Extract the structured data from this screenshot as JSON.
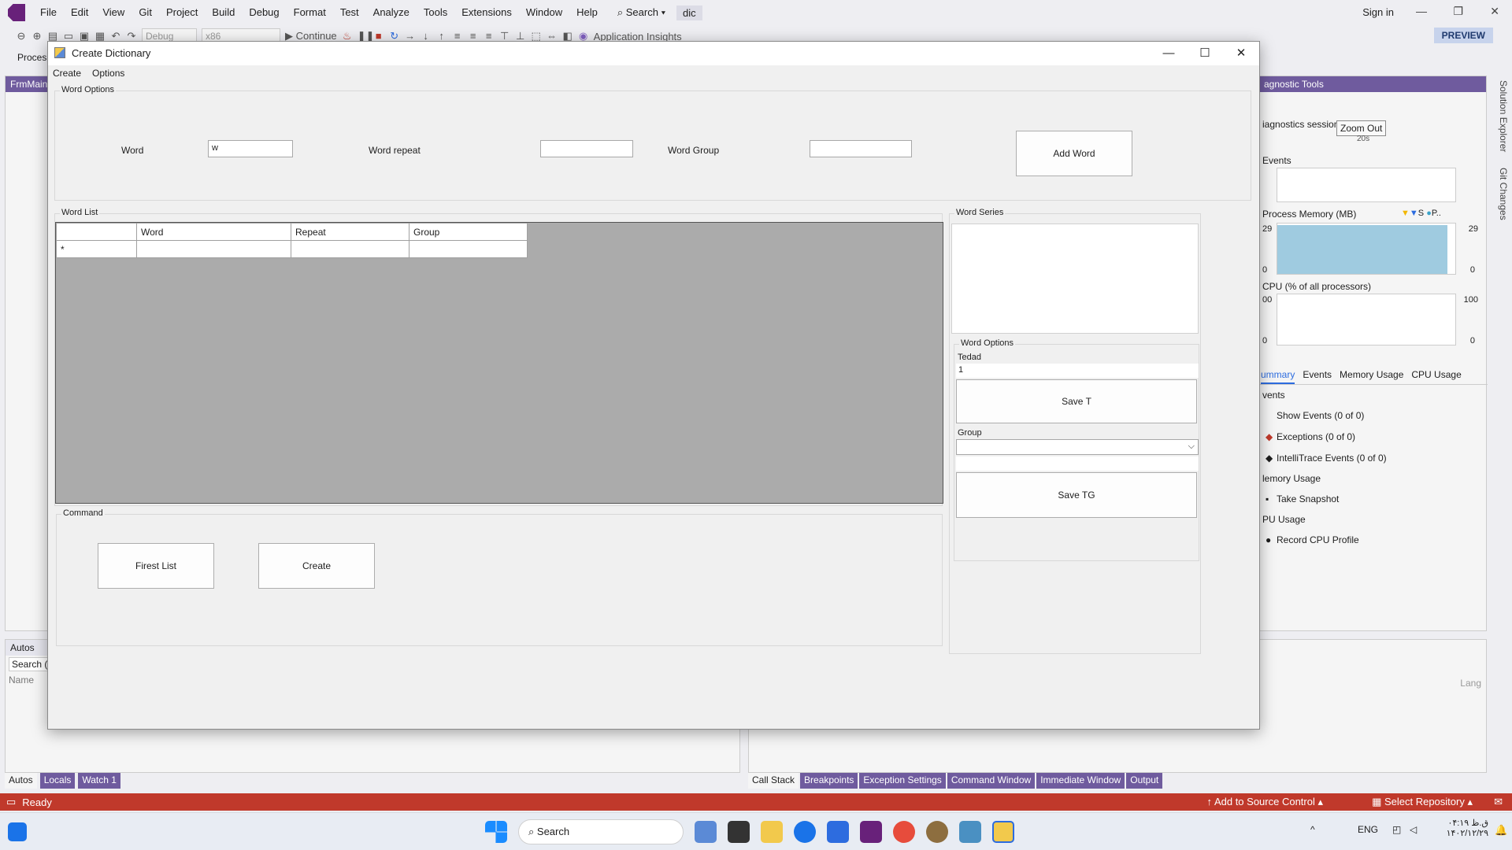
{
  "vs": {
    "menu": [
      "File",
      "Edit",
      "View",
      "Git",
      "Project",
      "Build",
      "Debug",
      "Format",
      "Test",
      "Analyze",
      "Tools",
      "Extensions",
      "Window",
      "Help"
    ],
    "search_label": "Search",
    "solution_name": "dic",
    "sign_in": "Sign in",
    "toolbar": {
      "config": "Debug",
      "platform": "x86",
      "continue_label": "Continue",
      "app_insights": "Application Insights",
      "preview": "PREVIEW"
    }
  },
  "background": {
    "left_doc_tab": "FrmMain",
    "process_label": "Proces",
    "autos_title": "Autos",
    "autos_search_placeholder": "Search (",
    "autos_col_name": "Name",
    "bottom_left_tabs": [
      "Autos",
      "Locals",
      "Watch 1"
    ],
    "bottom_right_tabs": [
      "Call Stack",
      "Breakpoints",
      "Exception Settings",
      "Command Window",
      "Immediate Window",
      "Output"
    ],
    "right_bottom_col": "Lang",
    "vertical_tabs": [
      "Solution Explorer",
      "Git Changes"
    ]
  },
  "diagnostics": {
    "title": "agnostic Tools",
    "session_label": "iagnostics session",
    "tooltip": "Zoom Out",
    "time_tick": "20s",
    "events_label": "Events",
    "memory_label": "Process Memory (MB)",
    "memory_legend": [
      "S",
      "P.."
    ],
    "memory_max": "29",
    "memory_min": "0",
    "cpu_label": "CPU (% of all processors)",
    "cpu_max_left": "00",
    "cpu_max_right": "100",
    "cpu_min": "0",
    "tabs": [
      "ummary",
      "Events",
      "Memory Usage",
      "CPU Usage"
    ],
    "events_section": "vents",
    "show_events": "Show Events (0 of 0)",
    "exceptions": "Exceptions (0 of 0)",
    "intellitrace": "IntelliTrace Events (0 of 0)",
    "memory_section": "lemory Usage",
    "take_snapshot": "Take Snapshot",
    "cpu_section": "PU Usage",
    "record_cpu": "Record CPU Profile"
  },
  "status": {
    "ready": "Ready",
    "add_source_control": "Add to Source Control",
    "select_repository": "Select Repository"
  },
  "taskbar": {
    "search": "Search",
    "lang": "ENG",
    "time": "۰۴:۱۹ ق.ظ",
    "date": "۱۴۰۲/۱۲/۲۹"
  },
  "dialog": {
    "title": "Create Dictionary",
    "menu": [
      "Create",
      "Options"
    ],
    "word_options_group": "Word Options",
    "word_label": "Word",
    "word_value": "w",
    "word_repeat_label": "Word repeat",
    "word_repeat_value": "",
    "word_group_label": "Word Group",
    "word_group_value": "",
    "add_word_button": "Add Word",
    "word_list_group": "Word List",
    "grid_columns": [
      "Word",
      "Repeat",
      "Group"
    ],
    "grid_new_row_marker": "*",
    "word_series_group": "Word Series",
    "right_options_group": "Word Options",
    "tedad_label": "Tedad",
    "tedad_value": "1",
    "save_t_button": "Save T",
    "group_label": "Group",
    "group_selected": "",
    "group_text_value": "",
    "save_tg_button": "Save TG",
    "command_group": "Command",
    "first_list_button": "Firest List",
    "create_button": "Create"
  }
}
